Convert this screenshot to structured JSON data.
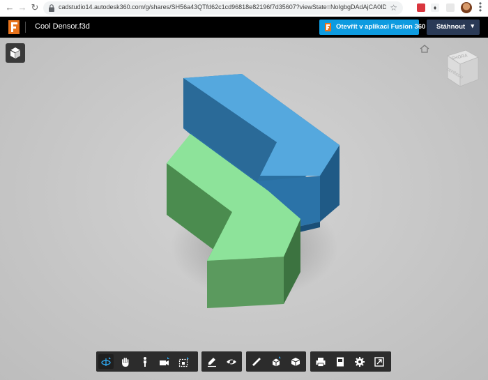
{
  "browser": {
    "url": "cadstudio14.autodesk360.com/g/shares/SH56a43QTfd62c1cd96818e82196f7d35607?viewState=NoIgbgDAdAjCA0IDeAdEAXAn..."
  },
  "header": {
    "file_name": "Cool Densor.f3d",
    "open_button_label": "Otevřít v aplikaci Fusion 360",
    "download_button_label": "Stáhnout"
  },
  "viewcube": {
    "top_label": "SHORA",
    "front_label": "ZEPŘEDU"
  },
  "colors": {
    "accent": "#0e9be0",
    "download_bg": "#2a3a56",
    "header_bg": "#000000",
    "part_blue": "#4a9fd8",
    "part_green": "#8ee09a"
  },
  "toolbar": {
    "groups": [
      [
        "orbit-icon",
        "pan-icon",
        "walk-icon",
        "camera-icon",
        "fit-icon"
      ],
      [
        "markup-icon",
        "visibility-icon"
      ],
      [
        "measure-icon",
        "explode-icon",
        "model-browser-icon"
      ],
      [
        "print-icon",
        "document-icon",
        "settings-icon",
        "fullscreen-icon"
      ]
    ]
  }
}
